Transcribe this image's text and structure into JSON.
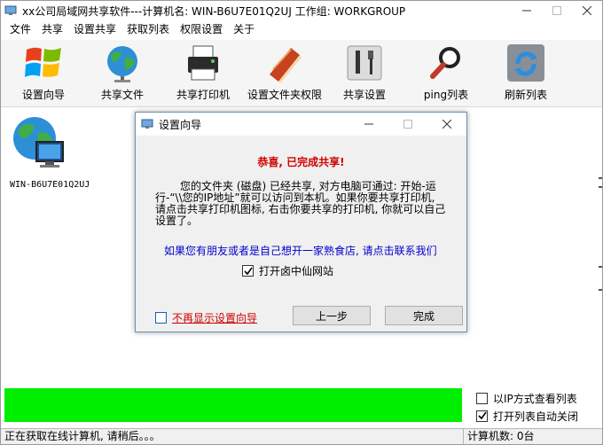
{
  "window": {
    "title": "xx公司局域网共享软件---计算机名: WIN-B6U7E01Q2UJ  工作组: WORKGROUP"
  },
  "menu": [
    "文件",
    "共享",
    "设置共享",
    "获取列表",
    "权限设置",
    "关于"
  ],
  "toolbar": [
    {
      "label": "设置向导",
      "icon": "windows-logo-icon"
    },
    {
      "label": "共享文件",
      "icon": "globe-icon"
    },
    {
      "label": "共享打印机",
      "icon": "printer-icon"
    },
    {
      "label": "设置文件夹权限",
      "icon": "book-icon"
    },
    {
      "label": "共享设置",
      "icon": "tools-icon"
    },
    {
      "label": "ping列表",
      "icon": "magnifier-icon"
    },
    {
      "label": "刷新列表",
      "icon": "refresh-icon"
    }
  ],
  "computers": [
    {
      "name": "WIN-B6U7E01Q2UJ"
    }
  ],
  "options": {
    "ip_view": {
      "label": "以IP方式查看列表",
      "checked": false
    },
    "auto_close": {
      "label": "打开列表自动关闭",
      "checked": true
    }
  },
  "status": {
    "message": "正在获取在线计算机, 请稍后。。。",
    "count": "计算机数: 0台"
  },
  "dialog": {
    "title": "设置向导",
    "heading": "恭喜, 已完成共享!",
    "body": "您的文件夹 (磁盘) 已经共享, 对方电脑可通过: 开始-运行-“\\\\您的IP地址”就可以访问到本机。如果你要共享打印机, 请点击共享打印机图标, 右击你要共享的打印机, 你就可以自己设置了。",
    "link": "如果您有朋友或者是自己想开一家熟食店, 请点击联系我们",
    "open_site": {
      "label": "打开卤中仙网站",
      "checked": true
    },
    "no_more": {
      "label": "不再显示设置向导",
      "checked": false
    },
    "prev_label": "上一步",
    "finish_label": "完成"
  },
  "colors": {
    "progress": "#00ee00",
    "heading": "#d00000",
    "link": "#0000cc"
  }
}
